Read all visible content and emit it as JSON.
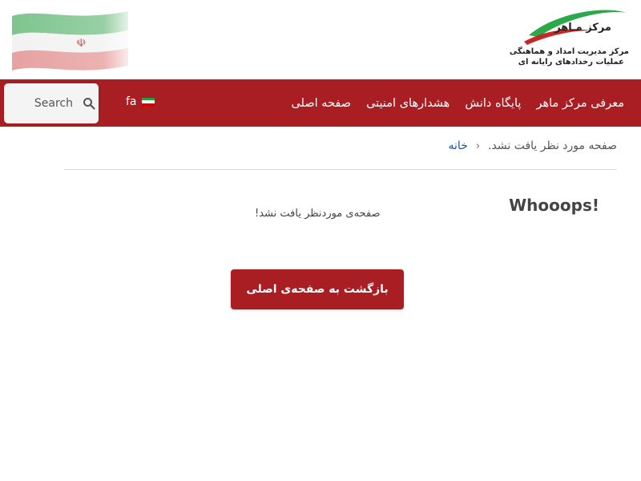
{
  "header": {
    "logo": {
      "title": "مرکز مـاهر",
      "subtitle_line1": "مرکز مدیریت امداد و هماهنگی",
      "subtitle_line2": "عملیات رخدادهای رایانه ای"
    }
  },
  "nav": {
    "items": [
      {
        "label": "صفحه اصلی"
      },
      {
        "label": "هشدارهای امنیتی"
      },
      {
        "label": "پایگاه دانش"
      },
      {
        "label": "معرفی مرکز ماهر"
      }
    ],
    "language": {
      "label": "fa"
    },
    "search": {
      "placeholder": "Search"
    }
  },
  "breadcrumb": {
    "home": "خانه",
    "separator": "‹",
    "current": "صفحه مورد نظر یافت نشد."
  },
  "main": {
    "heading": "Whooops!",
    "message": "صفحه‌ی موردنظر یافت نشد!",
    "button_label": "بازگشت به صفحه‌ی اصلی"
  },
  "colors": {
    "brand_red": "#a91e22",
    "logo_green": "#2aa84a",
    "link_blue": "#1a4fa8"
  }
}
